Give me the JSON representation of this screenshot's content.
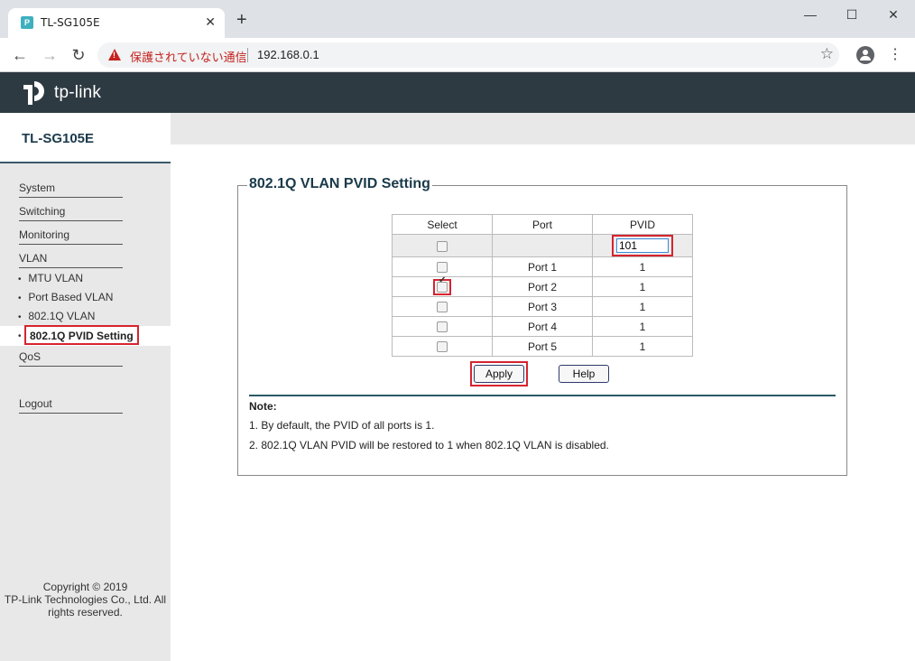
{
  "browser": {
    "tab_title": "TL-SG105E",
    "tab_close": "✕",
    "new_tab": "+",
    "minimize": "—",
    "maximize": "☐",
    "close": "✕",
    "back": "←",
    "forward": "→",
    "reload": "↻",
    "insecure_label": "保護されていない通信",
    "url": "192.168.0.1",
    "star": "☆",
    "menu": "⋮"
  },
  "brand": {
    "logo_text": "tp-link",
    "model": "TL-SG105E"
  },
  "sidebar": {
    "items": [
      {
        "label": "System"
      },
      {
        "label": "Switching"
      },
      {
        "label": "Monitoring"
      },
      {
        "label": "VLAN"
      }
    ],
    "vlan_sub": [
      {
        "label": "MTU VLAN"
      },
      {
        "label": "Port Based VLAN"
      },
      {
        "label": "802.1Q VLAN"
      },
      {
        "label": "802.1Q PVID Setting",
        "active": true
      }
    ],
    "qos": "QoS",
    "logout": "Logout",
    "copyright_1": "Copyright © 2019",
    "copyright_2": "TP-Link Technologies Co., Ltd. All",
    "copyright_3": "rights reserved."
  },
  "main": {
    "section_title": "802.1Q VLAN PVID Setting",
    "table": {
      "headers": [
        "Select",
        "Port",
        "PVID"
      ],
      "input_pvid": "101",
      "rows": [
        {
          "port": "Port 1",
          "pvid": "1",
          "checked": false
        },
        {
          "port": "Port 2",
          "pvid": "1",
          "checked": true
        },
        {
          "port": "Port 3",
          "pvid": "1",
          "checked": false
        },
        {
          "port": "Port 4",
          "pvid": "1",
          "checked": false
        },
        {
          "port": "Port 5",
          "pvid": "1",
          "checked": false
        }
      ]
    },
    "apply_label": "Apply",
    "help_label": "Help",
    "note_title": "Note:",
    "notes": [
      "1. By default, the PVID of all ports is 1.",
      "2. 802.1Q VLAN PVID will be restored to 1 when 802.1Q VLAN is disabled."
    ]
  },
  "colors": {
    "brand_bar": "#2e3a42",
    "highlight_red": "#d6242f",
    "title_teal": "#1a3a4a"
  }
}
